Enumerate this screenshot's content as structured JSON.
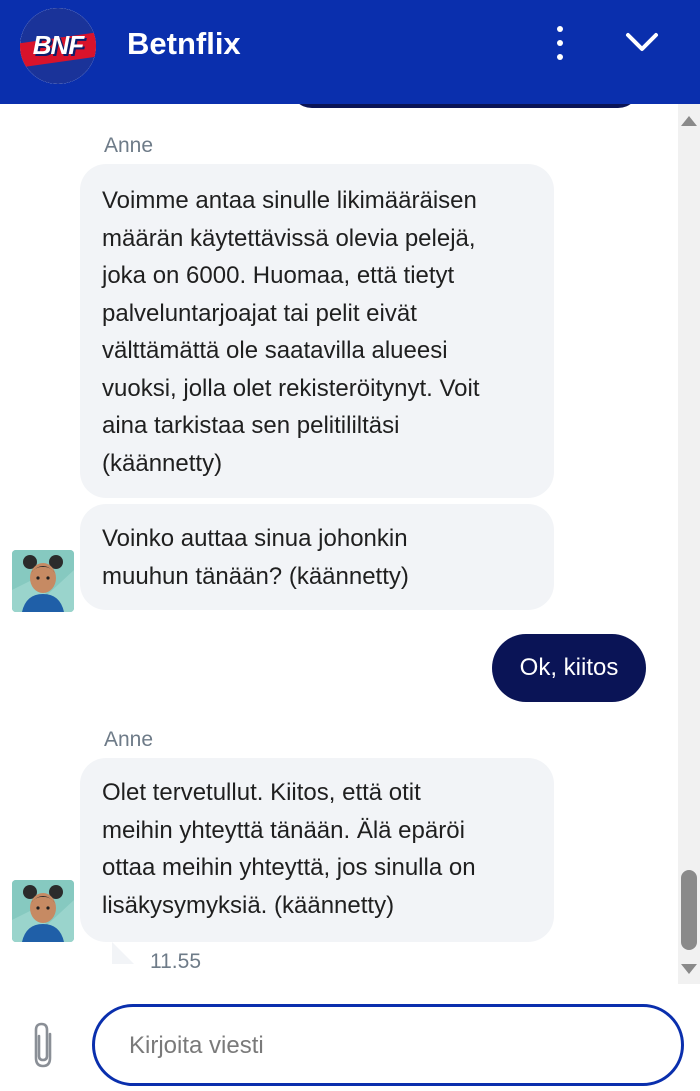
{
  "header": {
    "logo_text": "BNF",
    "title": "Betnflix",
    "menu_icon": "kebab-menu-icon",
    "collapse_icon": "chevron-down-icon"
  },
  "chat": {
    "messages": [
      {
        "sender": "Anne",
        "text": [
          "Voimme antaa sinulle likimääräisen",
          "määrän käytettävissä olevia pelejä,",
          "joka on 6000. Huomaa, että tietyt",
          "palveluntarjoajat tai pelit eivät",
          "välttämättä ole saatavilla alueesi",
          "vuoksi, jolla olet rekisteröitynyt. Voit",
          "aina tarkistaa sen pelitililtäsi",
          "(käännetty)"
        ]
      },
      {
        "text": [
          "Voinko auttaa sinua johonkin",
          "muuhun tänään? (käännetty)"
        ]
      },
      {
        "user_text": "Ok, kiitos"
      },
      {
        "sender": "Anne",
        "text": [
          "Olet tervetullut. Kiitos, että otit",
          "meihin yhteyttä tänään. Älä epäröi",
          "ottaa meihin yhteyttä, jos sinulla on",
          "lisäkysymyksiä. (käännetty)"
        ],
        "time": "11.55"
      }
    ]
  },
  "composer": {
    "placeholder": "Kirjoita viesti",
    "attach_icon": "paperclip-icon"
  },
  "colors": {
    "header_bg": "#0a2fad",
    "user_bubble": "#0a1456",
    "agent_bubble": "#f2f4f7"
  }
}
